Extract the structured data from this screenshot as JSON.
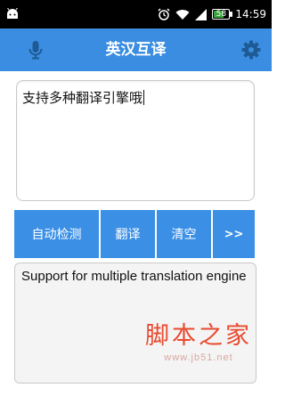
{
  "status_bar": {
    "time": "14:59",
    "battery_level": "58",
    "icons": [
      "android-icon",
      "alarm-icon",
      "wifi-icon",
      "signal-icon",
      "battery-icon"
    ]
  },
  "toolbar": {
    "title": "英汉互译",
    "left_icon": "microphone-icon",
    "right_icon": "gear-icon",
    "color": "#3a8de0"
  },
  "input": {
    "value": "支持多种翻译引擎哦"
  },
  "buttons": {
    "auto_detect": "自动检测",
    "translate": "翻译",
    "clear": "清空",
    "more": ">>"
  },
  "output": {
    "text": "Support for multiple translation engine"
  },
  "watermark": {
    "logo_text": "脚本之家",
    "url": "www.jb51.net"
  }
}
